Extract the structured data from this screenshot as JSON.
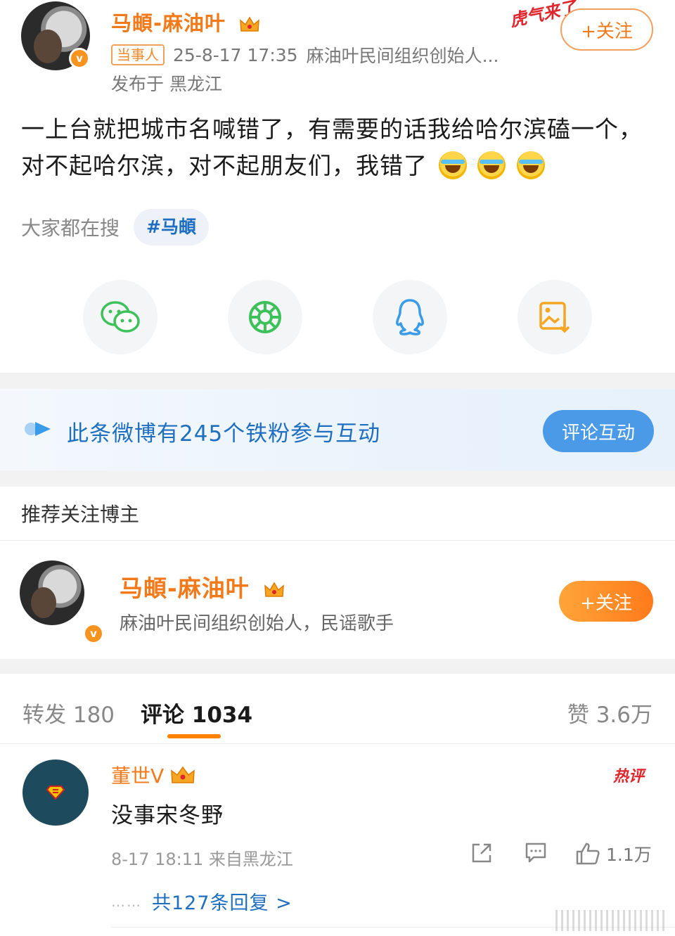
{
  "post": {
    "author": "马頔-麻油叶",
    "party_tag": "当事人",
    "timestamp": "25-8-17 17:35",
    "author_desc_short": "麻油叶民间组织创始人...",
    "location": "发布于 黑龙江",
    "follow_label": "+关注",
    "sticker_text": "虎气来了",
    "text": "一上台就把城市名喊错了，有需要的话我给哈尔滨磕一个，对不起哈尔滨，对不起朋友们，我错了",
    "emoji_count": 3,
    "search_label": "大家都在搜",
    "hashtag": "#马頔"
  },
  "share": {
    "items": [
      {
        "icon": "wechat-icon",
        "color": "#3ec15a"
      },
      {
        "icon": "moments-icon",
        "color": "#3ec15a"
      },
      {
        "icon": "qq-icon",
        "color": "#3a9be8"
      },
      {
        "icon": "save-image-icon",
        "color": "#f5a623"
      }
    ]
  },
  "fans_banner": {
    "text": "此条微博有245个铁粉参与互动",
    "button": "评论互动"
  },
  "recommend": {
    "title": "推荐关注博主",
    "name": "马頔-麻油叶",
    "desc": "麻油叶民间组织创始人，民谣歌手",
    "follow_label": "+关注"
  },
  "tabs": {
    "repost": "转发 180",
    "comments": "评论 1034",
    "likes": "赞 3.6万"
  },
  "comment": {
    "name": "董世V",
    "hot_tag": "热评",
    "text": "没事宋冬野",
    "meta": "8-17 18:11 来自黑龙江",
    "like_count": "1.1万",
    "replies_dots": "……",
    "replies": "共127条回复 >"
  },
  "colors": {
    "brand_orange": "#f27a1a",
    "link_blue": "#1f6fc1",
    "banner_button": "#4b9ae8"
  }
}
